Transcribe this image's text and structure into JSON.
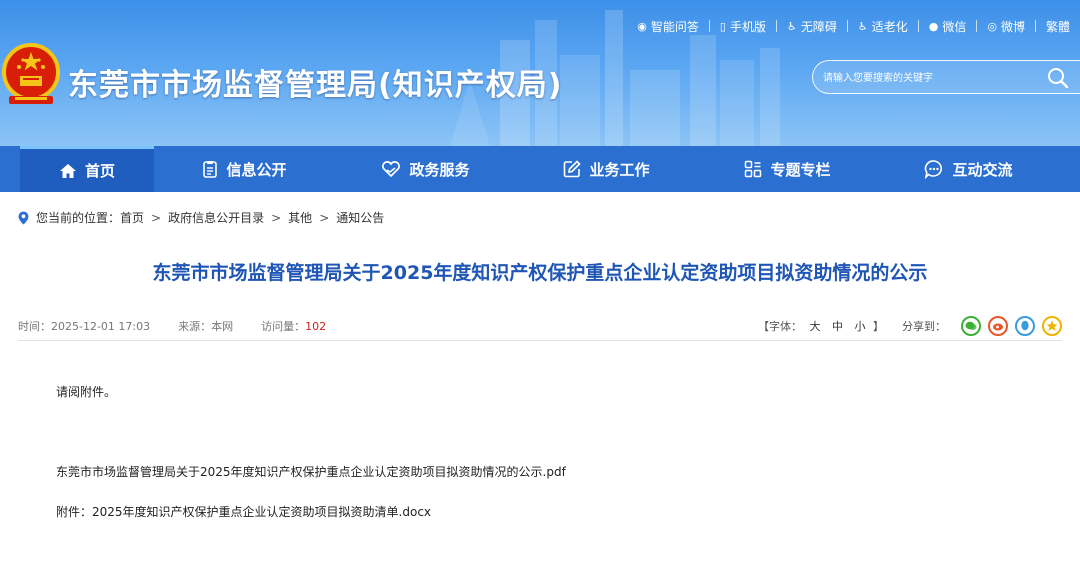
{
  "header": {
    "site_title": "东莞市市场监督管理局(知识产权局)",
    "top_links": [
      {
        "label": "智能问答",
        "icon": "chat-icon"
      },
      {
        "label": "手机版",
        "icon": "mobile-icon"
      },
      {
        "label": "无障碍",
        "icon": "accessibility-icon"
      },
      {
        "label": "适老化",
        "icon": "elderly-icon"
      },
      {
        "label": "微信",
        "icon": "wechat-icon"
      },
      {
        "label": "微博",
        "icon": "weibo-icon"
      },
      {
        "label": "繁體",
        "icon": ""
      }
    ],
    "search": {
      "placeholder": "请输入您要搜索的关键字"
    }
  },
  "nav": {
    "items": [
      {
        "label": "首页",
        "icon": "home-icon"
      },
      {
        "label": "信息公开",
        "icon": "document-icon"
      },
      {
        "label": "政务服务",
        "icon": "heart-hands-icon"
      },
      {
        "label": "业务工作",
        "icon": "edit-icon"
      },
      {
        "label": "专题专栏",
        "icon": "grid-icon"
      },
      {
        "label": "互动交流",
        "icon": "speech-bubble-icon"
      }
    ]
  },
  "breadcrumb": {
    "prefix": "您当前的位置：",
    "items": [
      "首页",
      "政府信息公开目录",
      "其他",
      "通知公告"
    ],
    "separator": ">"
  },
  "article": {
    "title": "东莞市市场监督管理局关于2025年度知识产权保护重点企业认定资助项目拟资助情况的公示",
    "meta": {
      "time_label": "时间：",
      "time": "2025-12-01 17:03",
      "source_label": "来源：",
      "source": "本网",
      "visits_label": "访问量：",
      "visits": "102",
      "fontsize_open": "【字体：",
      "fontsize_options": [
        "大",
        "中",
        "小"
      ],
      "fontsize_close": "】",
      "share_label": "分享到："
    },
    "share_icons": [
      {
        "name": "wechat-share-icon",
        "color": "#3cb034"
      },
      {
        "name": "weibo-share-icon",
        "color": "#e8572a"
      },
      {
        "name": "qq-share-icon",
        "color": "#3a9be0"
      },
      {
        "name": "qzone-share-icon",
        "color": "#f0b400"
      }
    ],
    "body": "请阅附件。",
    "attachment_pdf": "东莞市市场监督管理局关于2025年度知识产权保护重点企业认定资助项目拟资助情况的公示.pdf",
    "attachment_label": "附件：",
    "attachment_docx": "2025年度知识产权保护重点企业认定资助项目拟资助清单.docx"
  },
  "colors": {
    "nav_bg": "#2b6fd1",
    "title_blue": "#1f56b5",
    "visits_red": "#c22"
  }
}
